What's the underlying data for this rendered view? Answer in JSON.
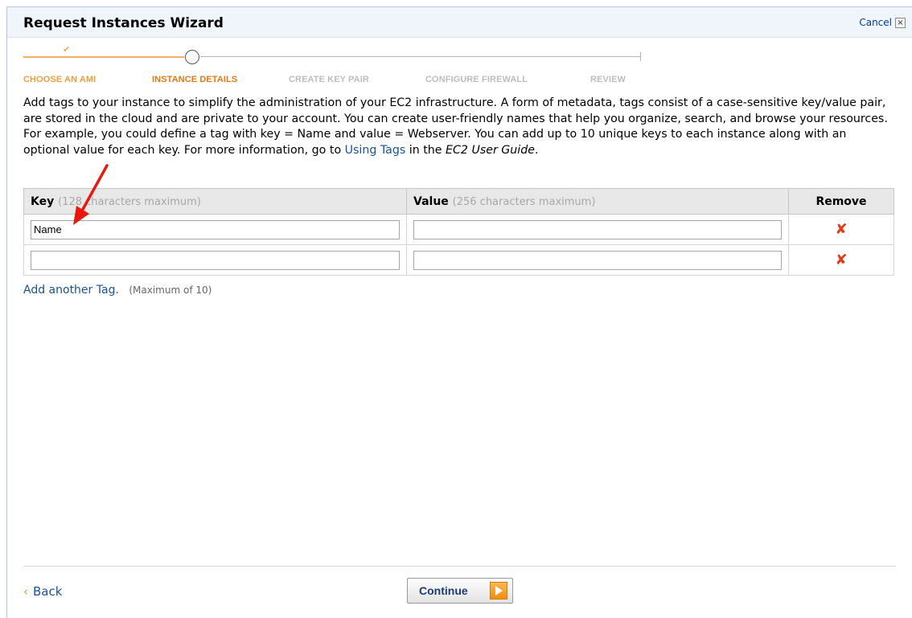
{
  "window": {
    "title": "Request Instances Wizard",
    "cancel_label": "Cancel",
    "close_glyph": "×"
  },
  "steps": [
    {
      "label": "CHOOSE AN AMI",
      "state": "done"
    },
    {
      "label": "INSTANCE DETAILS",
      "state": "current"
    },
    {
      "label": "CREATE KEY PAIR",
      "state": "future"
    },
    {
      "label": "CONFIGURE FIREWALL",
      "state": "future"
    },
    {
      "label": "REVIEW",
      "state": "future"
    }
  ],
  "intro": {
    "text_before_link": "Add tags to your instance to simplify the administration of your EC2 infrastructure. A form of metadata, tags consist of a case-sensitive key/value pair, are stored in the cloud and are private to your account. You can create user-friendly names that help you organize, search, and browse your resources. For example, you could define a tag with key = Name and value = Webserver. You can add up to 10 unique keys to each instance along with an optional value for each key. For more information, go to ",
    "link_text": "Using Tags",
    "text_middle": " in the ",
    "guide_text": "EC2 User Guide",
    "text_end": "."
  },
  "table": {
    "key_header": "Key",
    "key_hint": "(128 characters maximum)",
    "value_header": "Value",
    "value_hint": "(256 characters maximum)",
    "remove_header": "Remove",
    "rows": [
      {
        "key": "Name",
        "value": ""
      },
      {
        "key": "",
        "value": ""
      }
    ],
    "remove_glyph": "✘"
  },
  "add_tag": {
    "link_label": "Add another Tag.",
    "note": "(Maximum of 10)"
  },
  "footer": {
    "back_label": "Back",
    "back_chevron": "‹",
    "continue_label": "Continue"
  },
  "colors": {
    "accent_orange": "#e07a14",
    "link_blue": "#1a5293",
    "remove_red": "#e23a1a",
    "annotation_arrow": "#e8180c"
  }
}
